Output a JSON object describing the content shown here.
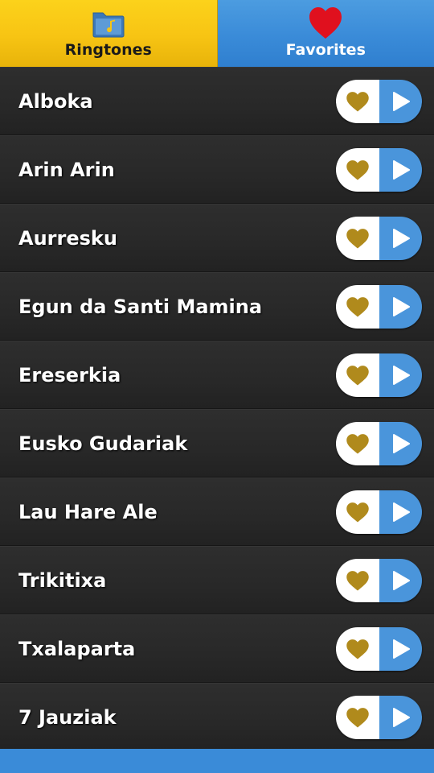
{
  "tabs": [
    {
      "label": "Ringtones",
      "icon": "music-folder-icon",
      "active": true,
      "color": "#f7c413"
    },
    {
      "label": "Favorites",
      "icon": "heart-icon",
      "active": false,
      "color": "#3a8bd8"
    }
  ],
  "ringtones": [
    {
      "title": "Alboka"
    },
    {
      "title": "Arin Arin"
    },
    {
      "title": "Aurresku"
    },
    {
      "title": "Egun da Santi Mamina"
    },
    {
      "title": "Ereserkia"
    },
    {
      "title": "Eusko Gudariak"
    },
    {
      "title": "Lau Hare Ale"
    },
    {
      "title": "Trikitixa"
    },
    {
      "title": "Txalaparta"
    },
    {
      "title": "7 Jauziak"
    }
  ],
  "row_actions": {
    "favorite_icon": "heart-icon",
    "play_icon": "play-icon"
  },
  "colors": {
    "favorite_heart": "#b08a1c",
    "play_button": "#4a95db",
    "bottom_bar": "#3a8bd8"
  }
}
